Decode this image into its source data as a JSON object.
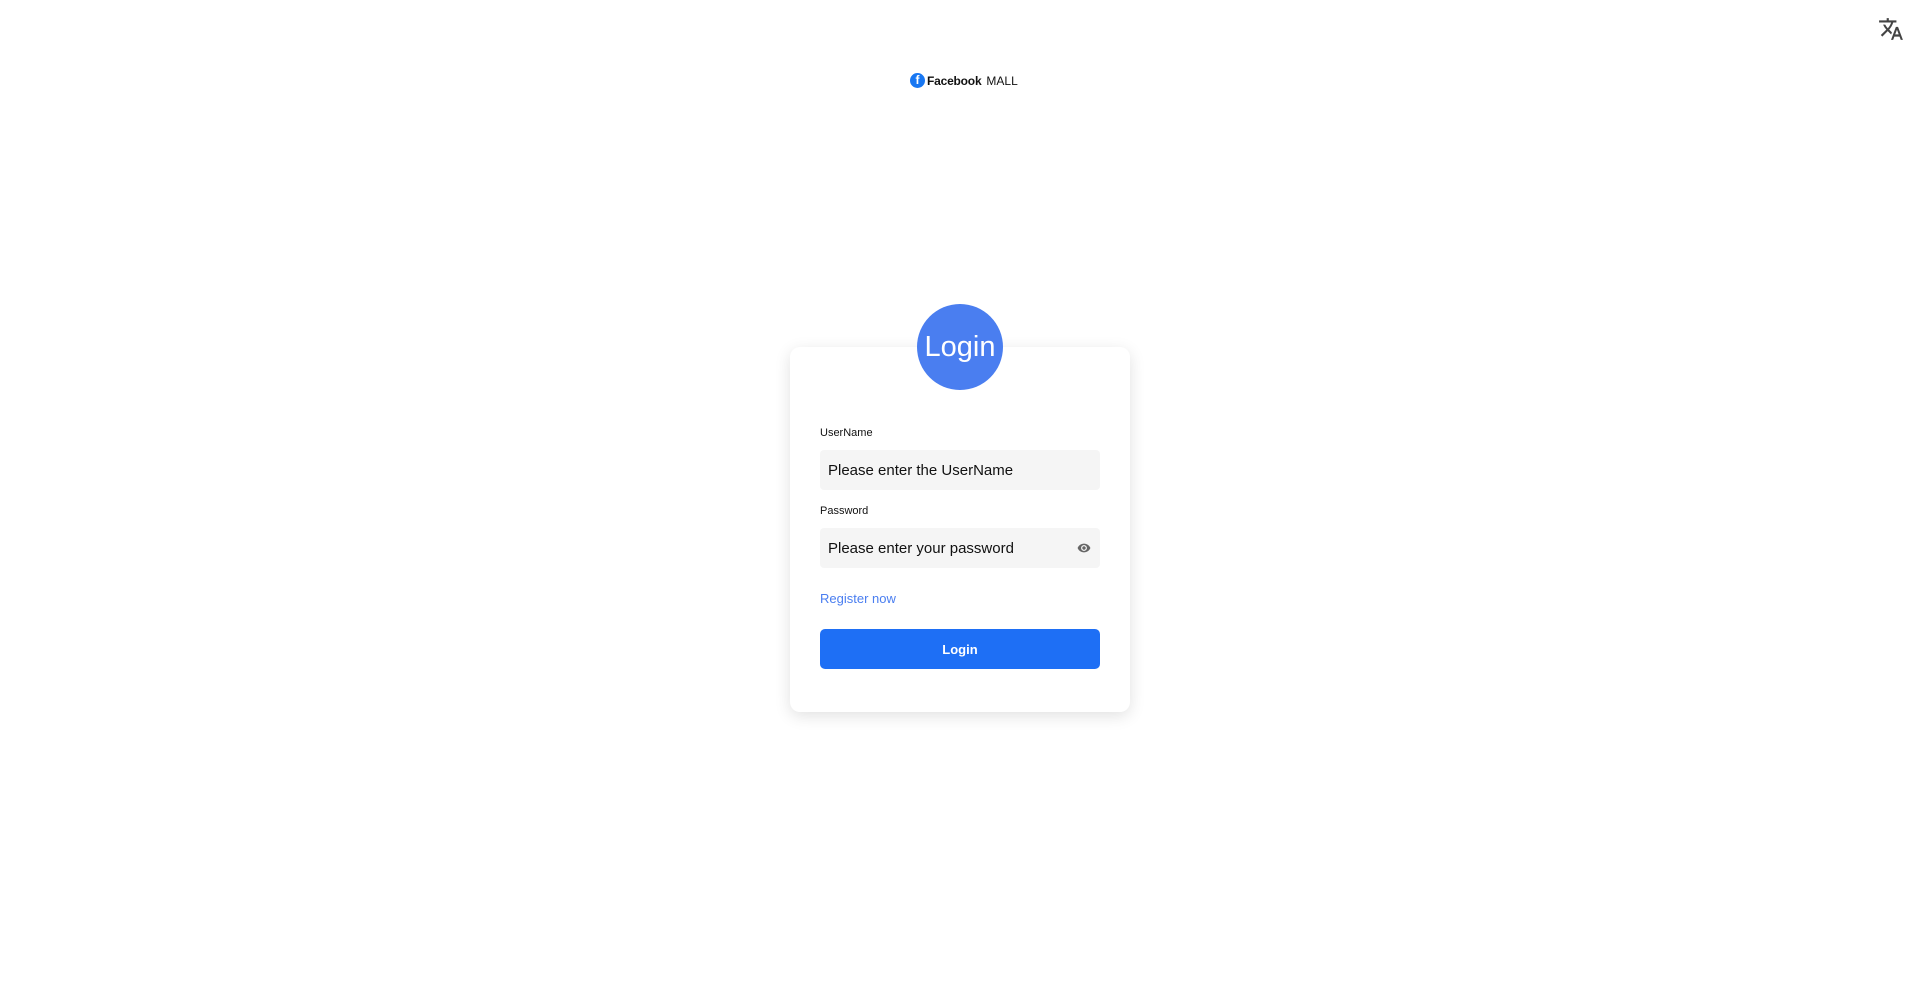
{
  "header": {
    "language_icon": "translate-icon",
    "brand": {
      "icon": "facebook-logo-icon",
      "icon_letter": "f",
      "name": "Facebook",
      "suffix": "MALL",
      "brand_color": "#1877f2"
    }
  },
  "login_card": {
    "badge_label": "Login",
    "badge_color": "#4a7ef0",
    "username": {
      "label": "UserName",
      "placeholder": "Please enter the UserName",
      "value": ""
    },
    "password": {
      "label": "Password",
      "placeholder": "Please enter your password",
      "value": "",
      "toggle_icon": "eye-icon"
    },
    "register_link": "Register now",
    "submit_label": "Login",
    "submit_color": "#1e6ff5"
  }
}
